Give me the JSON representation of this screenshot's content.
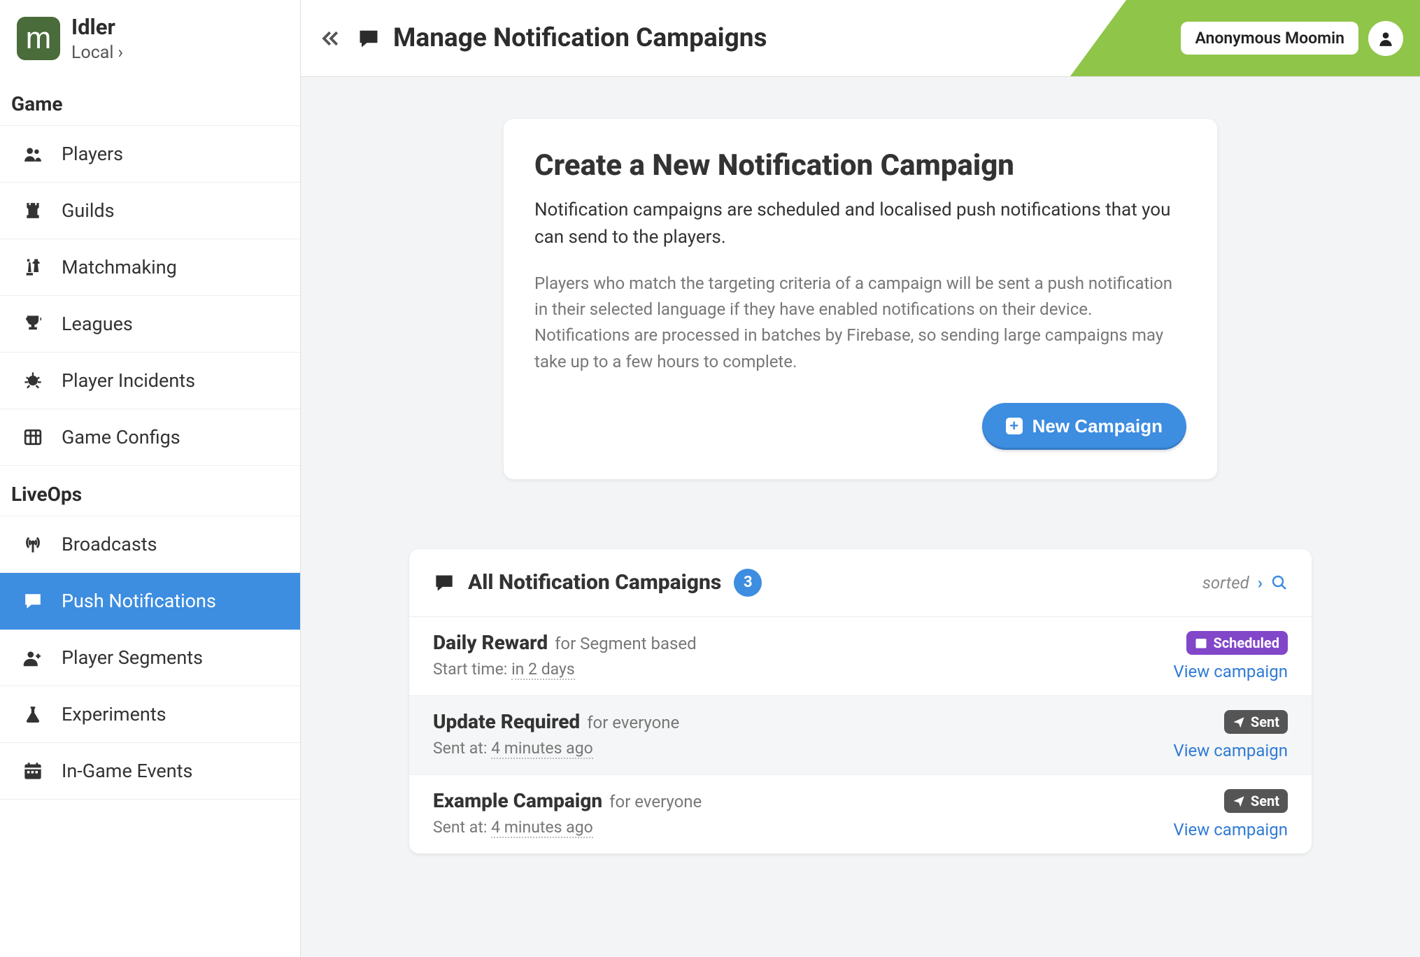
{
  "app": {
    "name": "Idler",
    "env": "Local",
    "logo_letter": "m"
  },
  "sidebar": {
    "sections": [
      {
        "label": "Game",
        "items": [
          {
            "id": "players",
            "label": "Players",
            "icon": "users"
          },
          {
            "id": "guilds",
            "label": "Guilds",
            "icon": "rook"
          },
          {
            "id": "matchmaking",
            "label": "Matchmaking",
            "icon": "chess"
          },
          {
            "id": "leagues",
            "label": "Leagues",
            "icon": "trophy"
          },
          {
            "id": "incidents",
            "label": "Player Incidents",
            "icon": "bug"
          },
          {
            "id": "configs",
            "label": "Game Configs",
            "icon": "grid"
          }
        ]
      },
      {
        "label": "LiveOps",
        "items": [
          {
            "id": "broadcasts",
            "label": "Broadcasts",
            "icon": "antenna"
          },
          {
            "id": "push",
            "label": "Push Notifications",
            "icon": "speech",
            "active": true
          },
          {
            "id": "segments",
            "label": "Player Segments",
            "icon": "user-plus"
          },
          {
            "id": "experiments",
            "label": "Experiments",
            "icon": "flask"
          },
          {
            "id": "events",
            "label": "In-Game Events",
            "icon": "calendar"
          }
        ]
      }
    ]
  },
  "header": {
    "title": "Manage Notification Campaigns",
    "user": "Anonymous Moomin"
  },
  "create": {
    "title": "Create a New Notification Campaign",
    "subtitle": "Notification campaigns are scheduled and localised push notifications that you can send to the players.",
    "description": "Players who match the targeting criteria of a campaign will be sent a push notification in their selected language if they have enabled notifications on their device. Notifications are processed in batches by Firebase, so sending large campaigns may take up to a few hours to complete.",
    "button": "New Campaign"
  },
  "list": {
    "title": "All Notification Campaigns",
    "count": "3",
    "sorted_label": "sorted",
    "view_label": "View campaign",
    "campaigns": [
      {
        "name": "Daily Reward",
        "target": "for Segment based",
        "meta_label": "Start time:",
        "meta_value": "in 2 days",
        "status": "Scheduled",
        "status_kind": "scheduled"
      },
      {
        "name": "Update Required",
        "target": "for everyone",
        "meta_label": "Sent at:",
        "meta_value": "4 minutes ago",
        "status": "Sent",
        "status_kind": "sent"
      },
      {
        "name": "Example Campaign",
        "target": "for everyone",
        "meta_label": "Sent at:",
        "meta_value": "4 minutes ago",
        "status": "Sent",
        "status_kind": "sent"
      }
    ]
  }
}
